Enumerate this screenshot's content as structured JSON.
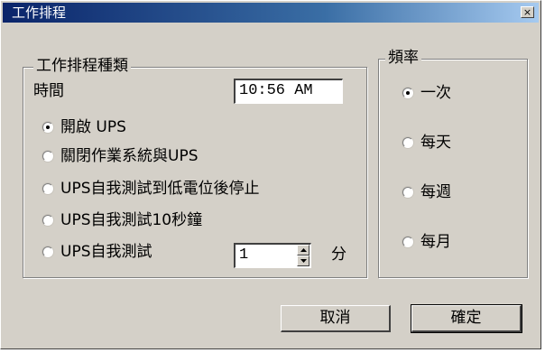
{
  "window": {
    "title": "工作排程",
    "close_glyph": "×"
  },
  "schedule_group": {
    "label": "工作排程種類",
    "time_label": "時間",
    "time_value": "10:56 AM",
    "options": [
      {
        "label": "開啟 UPS",
        "checked": true
      },
      {
        "label": "關閉作業系統與UPS",
        "checked": false
      },
      {
        "label": "UPS自我測試到低電位後停止",
        "checked": false
      },
      {
        "label": "UPS自我測試10秒鐘",
        "checked": false
      },
      {
        "label": "UPS自我測試",
        "checked": false
      }
    ],
    "minutes_value": "1",
    "minutes_unit": "分"
  },
  "frequency_group": {
    "label": "頻率",
    "options": [
      {
        "label": "一次",
        "checked": true
      },
      {
        "label": "每天",
        "checked": false
      },
      {
        "label": "每週",
        "checked": false
      },
      {
        "label": "每月",
        "checked": false
      }
    ]
  },
  "buttons": {
    "cancel": "取消",
    "ok": "確定"
  }
}
